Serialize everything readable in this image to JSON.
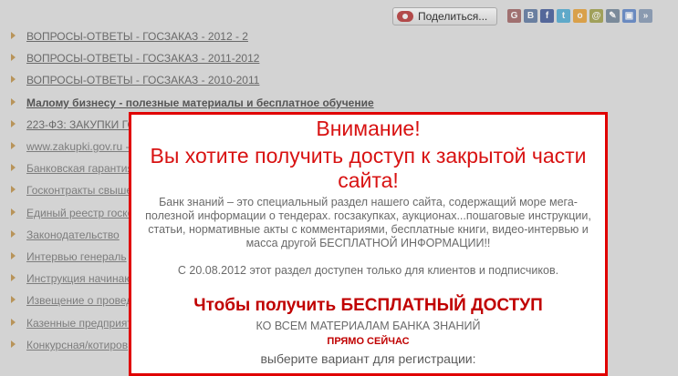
{
  "share": {
    "label": "Поделиться...",
    "icons": [
      {
        "name": "google-icon",
        "color": "#a07070",
        "glyph": "G"
      },
      {
        "name": "vkontakte-icon",
        "color": "#6a7fa0",
        "glyph": "B"
      },
      {
        "name": "facebook-icon",
        "color": "#54679a",
        "glyph": "f"
      },
      {
        "name": "twitter-icon",
        "color": "#5fa9c9",
        "glyph": "t"
      },
      {
        "name": "odnoklassniki-icon",
        "color": "#d9a04a",
        "glyph": "о"
      },
      {
        "name": "moimir-icon",
        "color": "#a0a05a",
        "glyph": "@"
      },
      {
        "name": "livejournal-icon",
        "color": "#7a8a9a",
        "glyph": "✎"
      },
      {
        "name": "bookmark-icon",
        "color": "#6a8ac0",
        "glyph": "▣"
      },
      {
        "name": "more-icon",
        "color": "#8a9ab0",
        "glyph": "»"
      }
    ]
  },
  "links": [
    {
      "text": "ВОПРОСЫ-ОТВЕТЫ - ГОСЗАКАЗ - 2012 - 2",
      "style": "normal"
    },
    {
      "text": "ВОПРОСЫ-ОТВЕТЫ - ГОСЗАКАЗ - 2011-2012",
      "style": "normal"
    },
    {
      "text": "ВОПРОСЫ-ОТВЕТЫ - ГОСЗАКАЗ - 2010-2011",
      "style": "normal"
    },
    {
      "text": "Малому бизнесу - полезные материалы и бесплатное обучение",
      "style": "bold"
    },
    {
      "text": "223-ФЗ: ЗАКУПКИ ГО",
      "style": "normal"
    },
    {
      "text": "www.zakupki.gov.ru -",
      "style": "dim"
    },
    {
      "text": "Банковская гарантия",
      "style": "dim"
    },
    {
      "text": "Госконтракты свыше",
      "style": "dim"
    },
    {
      "text": "Единый реестр госко",
      "style": "dim"
    },
    {
      "text": "Законодательство",
      "style": "dim"
    },
    {
      "text": "Интервью генераль",
      "style": "dim"
    },
    {
      "text": "Инструкция начинаю",
      "style": "dim"
    },
    {
      "text": "Извещение о провед",
      "style": "dim"
    },
    {
      "text": "Казенные предприят",
      "style": "dim"
    },
    {
      "text": "Конкурсная/котиров",
      "style": "dim"
    }
  ],
  "modal": {
    "title": "Внимание!",
    "subtitle": "Вы хотите получить доступ к закрытой части сайта!",
    "paragraph": "Банк знаний – это специальный раздел нашего сайта, содержащий море мега-полезной информации о тендерах. госзакупках, аукционах...пошаговые инструкции, статьи, нормативные акты с комментариями, бесплатные книги, видео-интервью и масса другой БЕСПЛАТНОЙ ИНФОРМАЦИИ!!",
    "date_notice": "С 20.08.2012  этот раздел доступен только для клиентов и подписчиков.",
    "cta": "Чтобы получить БЕСПЛАТНЫЙ ДОСТУП",
    "all_materials": "КО ВСЕМ МАТЕРИАЛАМ БАНКА ЗНАНИЙ",
    "right_now": "ПРЯМО СЕЙЧАС",
    "choose": "выберите вариант для регистрации:"
  }
}
